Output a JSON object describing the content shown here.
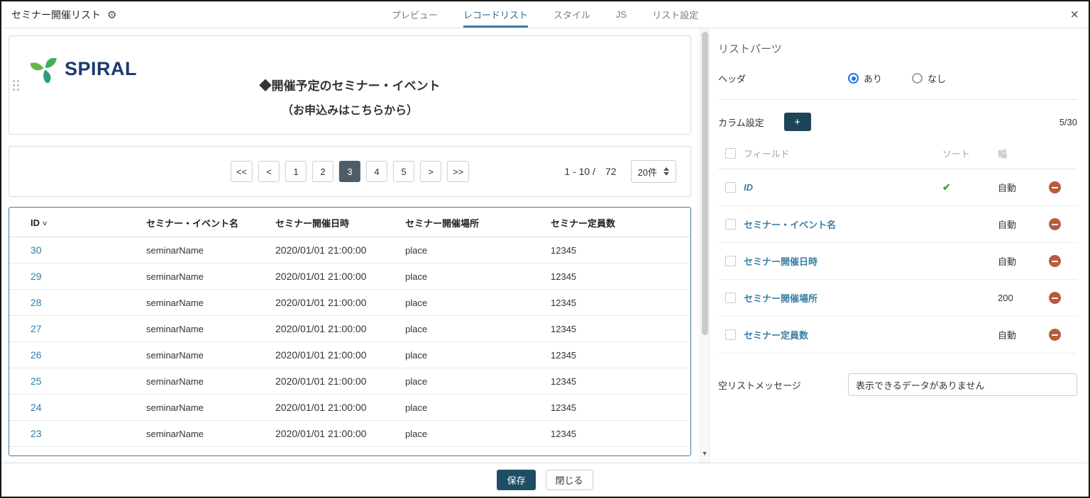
{
  "header": {
    "title": "セミナー開催リスト",
    "tabs": [
      "プレビュー",
      "レコードリスト",
      "スタイル",
      "JS",
      "リスト設定"
    ]
  },
  "icons": {
    "gear": "⚙",
    "close": "×",
    "sort_check": "✔",
    "id_chevron": "˅",
    "scroll_down": "▼",
    "add": "+"
  },
  "preview": {
    "logo_text": "SPIRAL",
    "title_line1": "◆開催予定のセミナー・イベント",
    "title_line2": "（お申込みはこちらから）",
    "pagination": {
      "first": "<<",
      "prev": "<",
      "pages": [
        "1",
        "2",
        "3",
        "4",
        "5"
      ],
      "active_page": "3",
      "next": ">",
      "last": ">>",
      "range": "1 - 10 /",
      "total": "72",
      "per_page": "20件"
    },
    "table": {
      "columns": [
        "ID",
        "セミナー・イベント名",
        "セミナー開催日時",
        "セミナー開催場所",
        "セミナー定員数"
      ],
      "rows": [
        {
          "id": "30",
          "name": "seminarName",
          "datetime": "2020/01/01 21:00:00",
          "place": "place",
          "capacity": "12345"
        },
        {
          "id": "29",
          "name": "seminarName",
          "datetime": "2020/01/01 21:00:00",
          "place": "place",
          "capacity": "12345"
        },
        {
          "id": "28",
          "name": "seminarName",
          "datetime": "2020/01/01 21:00:00",
          "place": "place",
          "capacity": "12345"
        },
        {
          "id": "27",
          "name": "seminarName",
          "datetime": "2020/01/01 21:00:00",
          "place": "place",
          "capacity": "12345"
        },
        {
          "id": "26",
          "name": "seminarName",
          "datetime": "2020/01/01 21:00:00",
          "place": "place",
          "capacity": "12345"
        },
        {
          "id": "25",
          "name": "seminarName",
          "datetime": "2020/01/01 21:00:00",
          "place": "place",
          "capacity": "12345"
        },
        {
          "id": "24",
          "name": "seminarName",
          "datetime": "2020/01/01 21:00:00",
          "place": "place",
          "capacity": "12345"
        },
        {
          "id": "23",
          "name": "seminarName",
          "datetime": "2020/01/01 21:00:00",
          "place": "place",
          "capacity": "12345"
        }
      ]
    }
  },
  "panel": {
    "title": "リストパーツ",
    "header_setting": {
      "label": "ヘッダ",
      "option_yes": "あり",
      "option_no": "なし",
      "selected": "あり"
    },
    "column_setting": {
      "label": "カラム設定",
      "count": "5/30"
    },
    "field_table": {
      "col_field": "フィールド",
      "col_sort": "ソート",
      "col_width": "幅",
      "rows": [
        {
          "name": "ID",
          "sort": "✔",
          "width": "自動"
        },
        {
          "name": "セミナー・イベント名",
          "sort": "",
          "width": "自動"
        },
        {
          "name": "セミナー開催日時",
          "sort": "",
          "width": "自動"
        },
        {
          "name": "セミナー開催場所",
          "sort": "",
          "width": "200"
        },
        {
          "name": "セミナー定員数",
          "sort": "",
          "width": "自動"
        }
      ]
    },
    "empty_message": {
      "label": "空リストメッセージ",
      "value": "表示できるデータがありません"
    }
  },
  "footer": {
    "save": "保存",
    "close": "閉じる"
  },
  "colors": {
    "accent": "#3a7ca5",
    "save_button": "#1e4e63",
    "active_page": "#4d5c66",
    "link": "#2e7fa8",
    "check": "#38a650",
    "minus": "#b85c3e",
    "radio_selected": "#1a73e8"
  }
}
